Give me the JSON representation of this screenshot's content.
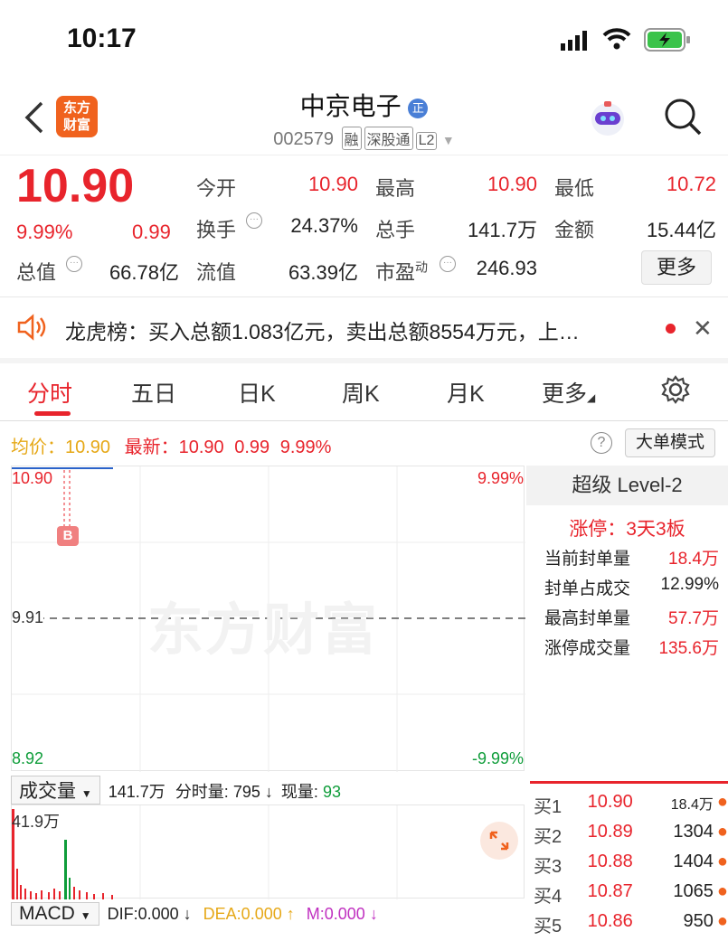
{
  "status": {
    "time": "10:17"
  },
  "header": {
    "back_icon": "chevron-left-icon",
    "logo_line1": "东方",
    "logo_line2": "财富",
    "stock_name": "中京电子",
    "name_badge": "正",
    "stock_code": "002579",
    "tags": [
      "融",
      "深股通",
      "L2"
    ],
    "avatar_icon": "robot-avatar-icon",
    "search_icon": "search-icon"
  },
  "quote": {
    "price": "10.90",
    "change_pct": "9.99%",
    "change": "0.99",
    "open_label": "今开",
    "open": "10.90",
    "high_label": "最高",
    "high": "10.90",
    "low_label": "最低",
    "low": "10.72",
    "turnover_label": "换手",
    "turnover": "24.37%",
    "volume_label": "总手",
    "volume": "141.7万",
    "amount_label": "金额",
    "amount": "15.44亿",
    "mktcap_label": "总值",
    "mktcap": "66.78亿",
    "float_label": "流值",
    "float": "63.39亿",
    "pe_label": "市盈",
    "pe_sup": "动",
    "pe": "246.93",
    "more_label": "更多"
  },
  "notice": {
    "text": "龙虎榜：买入总额1.083亿元，卖出总额8554万元，上…"
  },
  "tabs": [
    "分时",
    "五日",
    "日K",
    "周K",
    "月K",
    "更多"
  ],
  "active_tab": "分时",
  "chart_header": {
    "avg_label": "均价：",
    "avg": "10.90",
    "latest_label": "最新：",
    "latest": "10.90",
    "chg": "0.99",
    "pct": "9.99%",
    "big_order_label": "大单模式"
  },
  "chart": {
    "y_top": "10.90",
    "y_mid": "9.91",
    "y_bottom": "8.92",
    "pct_top": "9.99%",
    "pct_bottom": "-9.99%",
    "marker": "B",
    "watermark": "东方财富"
  },
  "level2": {
    "title": "超级 Level-2",
    "limit_up": "涨停：3天3板",
    "rows": [
      {
        "label": "当前封单量",
        "value": "18.4万"
      },
      {
        "label": "封单占成交",
        "value": "12.99%"
      },
      {
        "label": "最高封单量",
        "value": "57.7万"
      },
      {
        "label": "涨停成交量",
        "value": "135.6万"
      }
    ]
  },
  "order_book": [
    {
      "label": "买1",
      "price": "10.90",
      "qty": "18.4万"
    },
    {
      "label": "买2",
      "price": "10.89",
      "qty": "1304"
    },
    {
      "label": "买3",
      "price": "10.88",
      "qty": "1404"
    },
    {
      "label": "买4",
      "price": "10.87",
      "qty": "1065"
    },
    {
      "label": "买5",
      "price": "10.86",
      "qty": "950"
    }
  ],
  "volume_panel": {
    "selector": "成交量",
    "total": "141.7万",
    "minute_label": "分时量:",
    "minute": "795",
    "now_label": "现量:",
    "now": "93",
    "max_label": "41.9万"
  },
  "macd_panel": {
    "selector": "MACD",
    "dif": "DIF:0.000",
    "dea": "DEA:0.000",
    "m": "M:0.000"
  },
  "colors": {
    "up": "#e8242c",
    "down": "#0f9d3a",
    "brand": "#f0621e",
    "avg": "#e6a817"
  }
}
